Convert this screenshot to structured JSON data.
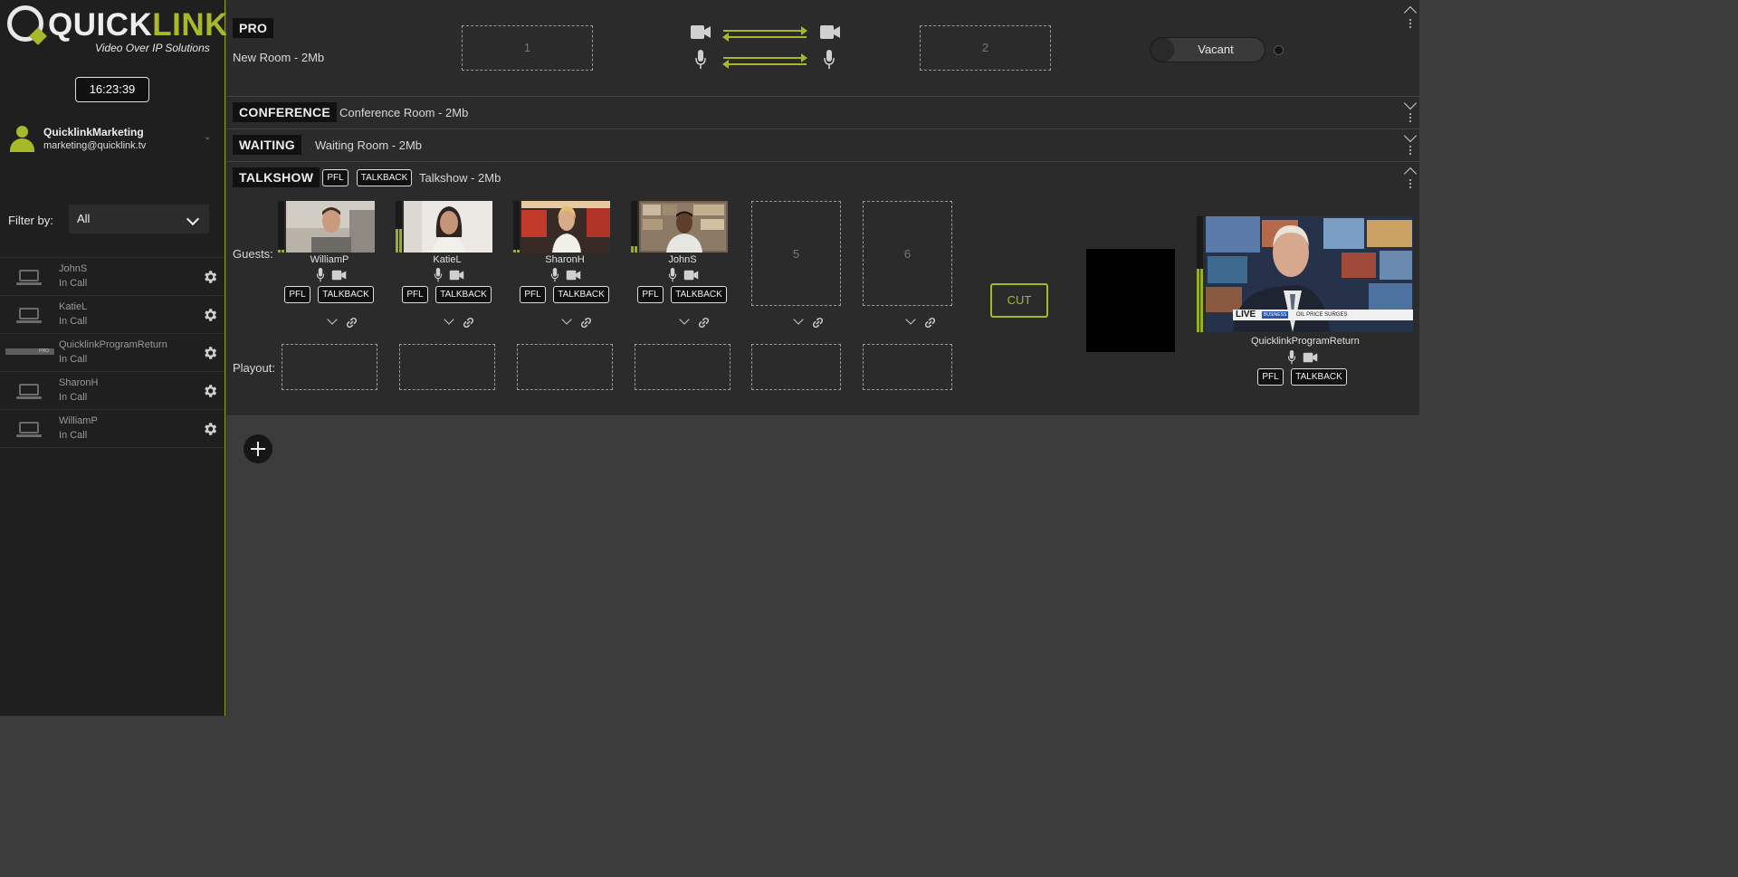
{
  "brand": {
    "logo_quick": "QUICK",
    "logo_link": "LINK",
    "tagline": "Video Over IP Solutions",
    "accent_color": "#a7b829"
  },
  "clock": "16:23:39",
  "user": {
    "name": "QuicklinkMarketing",
    "email": "marketing@quicklink.tv"
  },
  "filter": {
    "label": "Filter by:",
    "value": "All"
  },
  "participants": [
    {
      "name": "JohnS",
      "status": "In Call",
      "device": "laptop-icon"
    },
    {
      "name": "KatieL",
      "status": "In Call",
      "device": "laptop-icon"
    },
    {
      "name": "QuicklinkProgramReturn",
      "status": "In Call",
      "device": "rack-device-icon"
    },
    {
      "name": "SharonH",
      "status": "In Call",
      "device": "laptop-icon"
    },
    {
      "name": "WilliamP",
      "status": "In Call",
      "device": "laptop-icon"
    }
  ],
  "rooms": {
    "pro": {
      "tag": "PRO",
      "name": "New Room - 2Mb",
      "slot1": "1",
      "slot2": "2",
      "toggle_label": "Vacant"
    },
    "conference": {
      "tag": "CONFERENCE",
      "name": "Conference Room - 2Mb"
    },
    "waiting": {
      "tag": "WAITING",
      "name": "Waiting Room - 2Mb"
    },
    "talkshow": {
      "tag": "TALKSHOW",
      "pfl": "PFL",
      "talkback": "TALKBACK",
      "name": "Talkshow - 2Mb",
      "guests_label": "Guests:",
      "playout_label": "Playout:",
      "cut_label": "CUT",
      "guests": [
        {
          "name": "WilliamP",
          "pfl": "PFL",
          "talkback": "TALKBACK",
          "audio_level": 0.05
        },
        {
          "name": "KatieL",
          "pfl": "PFL",
          "talkback": "TALKBACK",
          "audio_level": 0.45
        },
        {
          "name": "SharonH",
          "pfl": "PFL",
          "talkback": "TALKBACK",
          "audio_level": 0.05
        },
        {
          "name": "JohnS",
          "pfl": "PFL",
          "talkback": "TALKBACK",
          "audio_level": 0.12
        }
      ],
      "empty_slots": [
        "5",
        "6"
      ],
      "program": {
        "name": "QuicklinkProgramReturn",
        "pfl": "PFL",
        "talkback": "TALKBACK",
        "audio_level": 0.55,
        "ticker_live": "LIVE",
        "ticker_tag": "BUSINESS",
        "ticker_text": "OIL PRICE SURGES"
      }
    }
  }
}
